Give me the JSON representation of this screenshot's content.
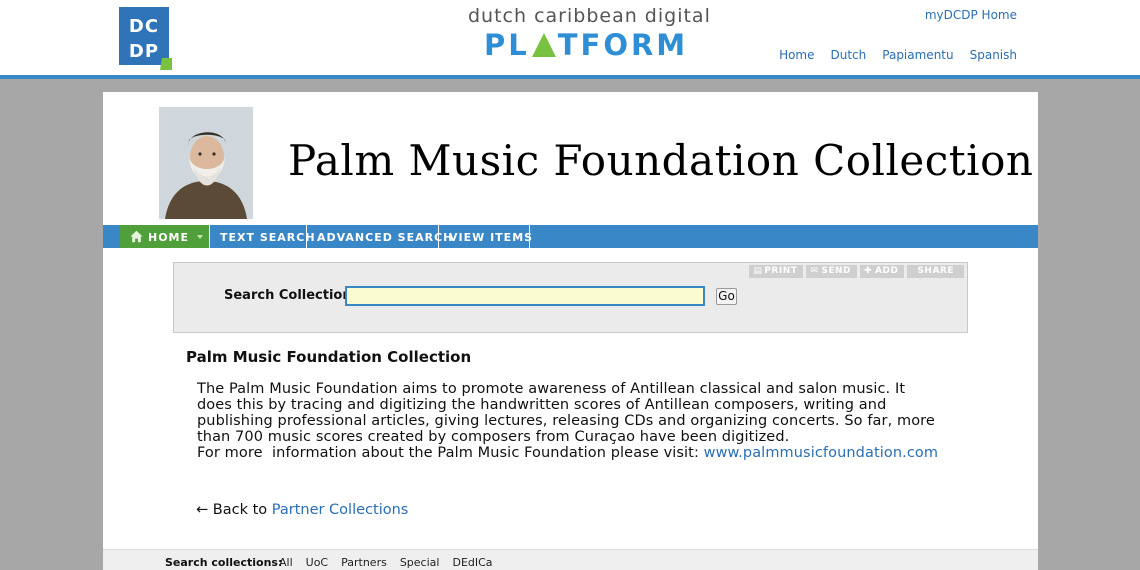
{
  "header": {
    "logo_text": "DCDP",
    "brand_line1": "dutch caribbean digital",
    "brand_line2_prefix": "PL",
    "brand_line2_suffix": "TFORM",
    "mydcdp_link": "myDCDP Home",
    "lang_nav": [
      "Home",
      "Dutch",
      "Papiamentu",
      "Spanish"
    ]
  },
  "collection": {
    "title": "Palm Music Foundation Collection",
    "portrait_alt": "Portrait of Jan Gerard Palm"
  },
  "nav": {
    "home": "Home",
    "text_search": "Text Search",
    "advanced_search": "Advanced Search",
    "view_items": "View Items"
  },
  "search": {
    "label": "Search Collection:",
    "value": "",
    "go_label": "Go",
    "tools": [
      "Print",
      "Send",
      "Add",
      "Share"
    ]
  },
  "content": {
    "heading": "Palm Music Foundation Collection",
    "paragraph": "The Palm Music Foundation aims to promote awareness of Antillean classical and salon music. It does this by tracing and digitizing the handwritten scores of Antillean composers, writing and publishing professional articles, giving lectures, releasing CDs and organizing concerts. So far, more than 700 music scores created by composers from Curaçao have been digitized.",
    "more_info_prefix": "For more  information about the Palm Music Foundation please visit: ",
    "more_info_link": "www.palmmusicfoundation.com",
    "back_arrow": "←",
    "back_prefix": " Back to ",
    "back_link": "Partner Collections"
  },
  "footer": {
    "label": "Search collections:",
    "links": [
      "All",
      "UoC",
      "Partners",
      "Special",
      "DEdICa"
    ]
  },
  "colors": {
    "accent_blue": "#3a87c8",
    "home_green": "#4fa03a",
    "link_blue": "#2a6eb5"
  }
}
